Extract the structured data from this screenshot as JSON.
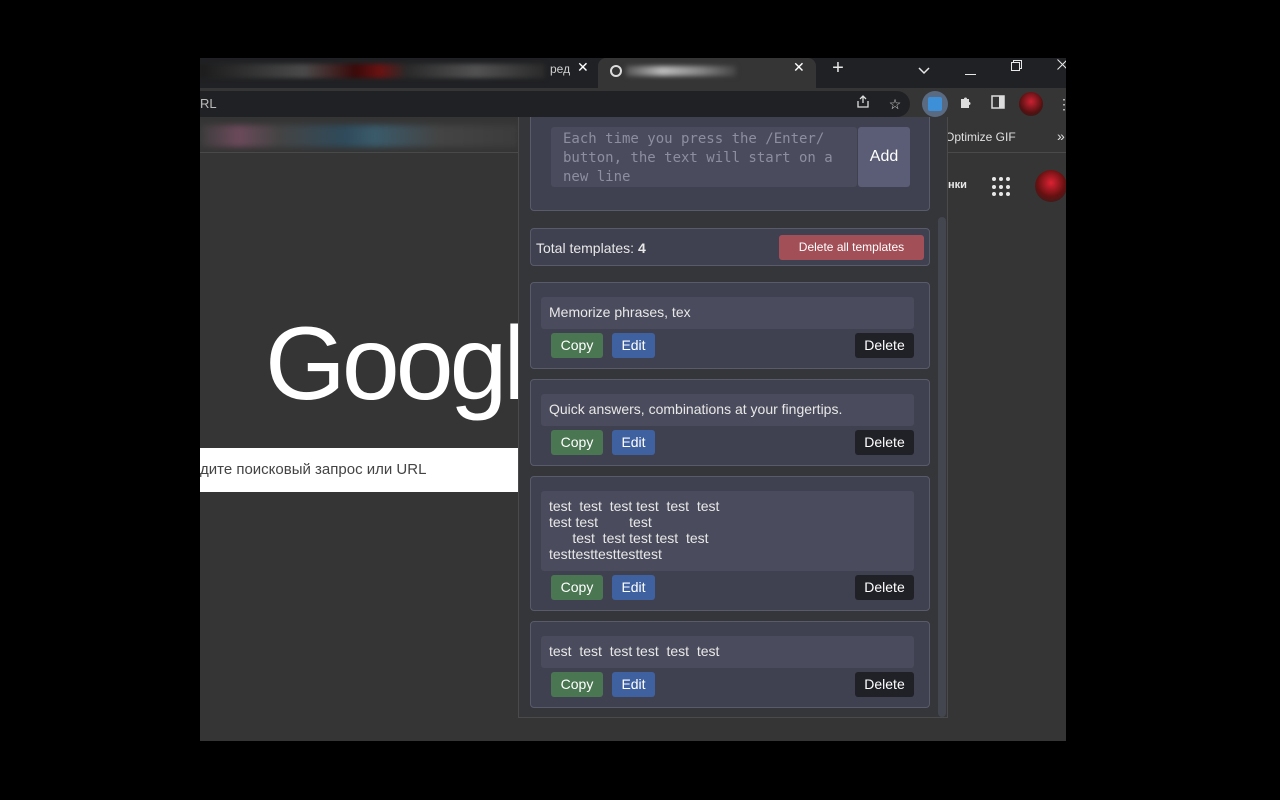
{
  "browser": {
    "tab1_label_tail": "ред",
    "omnibox_fragment": "RL",
    "bookmark_visible": "Optimize GIF",
    "bookmarks_more": "»",
    "header_link_fragment": "нки"
  },
  "page": {
    "logo_text": "Google",
    "search_placeholder": "дите поисковый запрос или URL"
  },
  "popup": {
    "input_placeholder": "Each time you press the /Enter/ button, the text will start on a new line",
    "add_label": "Add",
    "total_label": "Total templates: ",
    "total_count": "4",
    "delete_all_label": "Delete all templates",
    "copy_label": "Copy",
    "edit_label": "Edit",
    "delete_label": "Delete",
    "templates": [
      {
        "text": "Memorize phrases, tex"
      },
      {
        "text": "Quick answers, combinations at your fingertips."
      },
      {
        "text": "test  test  test test  test  test\ntest test        test\n      test  test test test  test\ntesttesttesttesttest"
      },
      {
        "text": "test  test  test test  test  test"
      }
    ]
  },
  "colors": {
    "copy": "#4a7652",
    "edit": "#3f61a0",
    "delete_all": "#a24f57",
    "delete": "#202126"
  }
}
